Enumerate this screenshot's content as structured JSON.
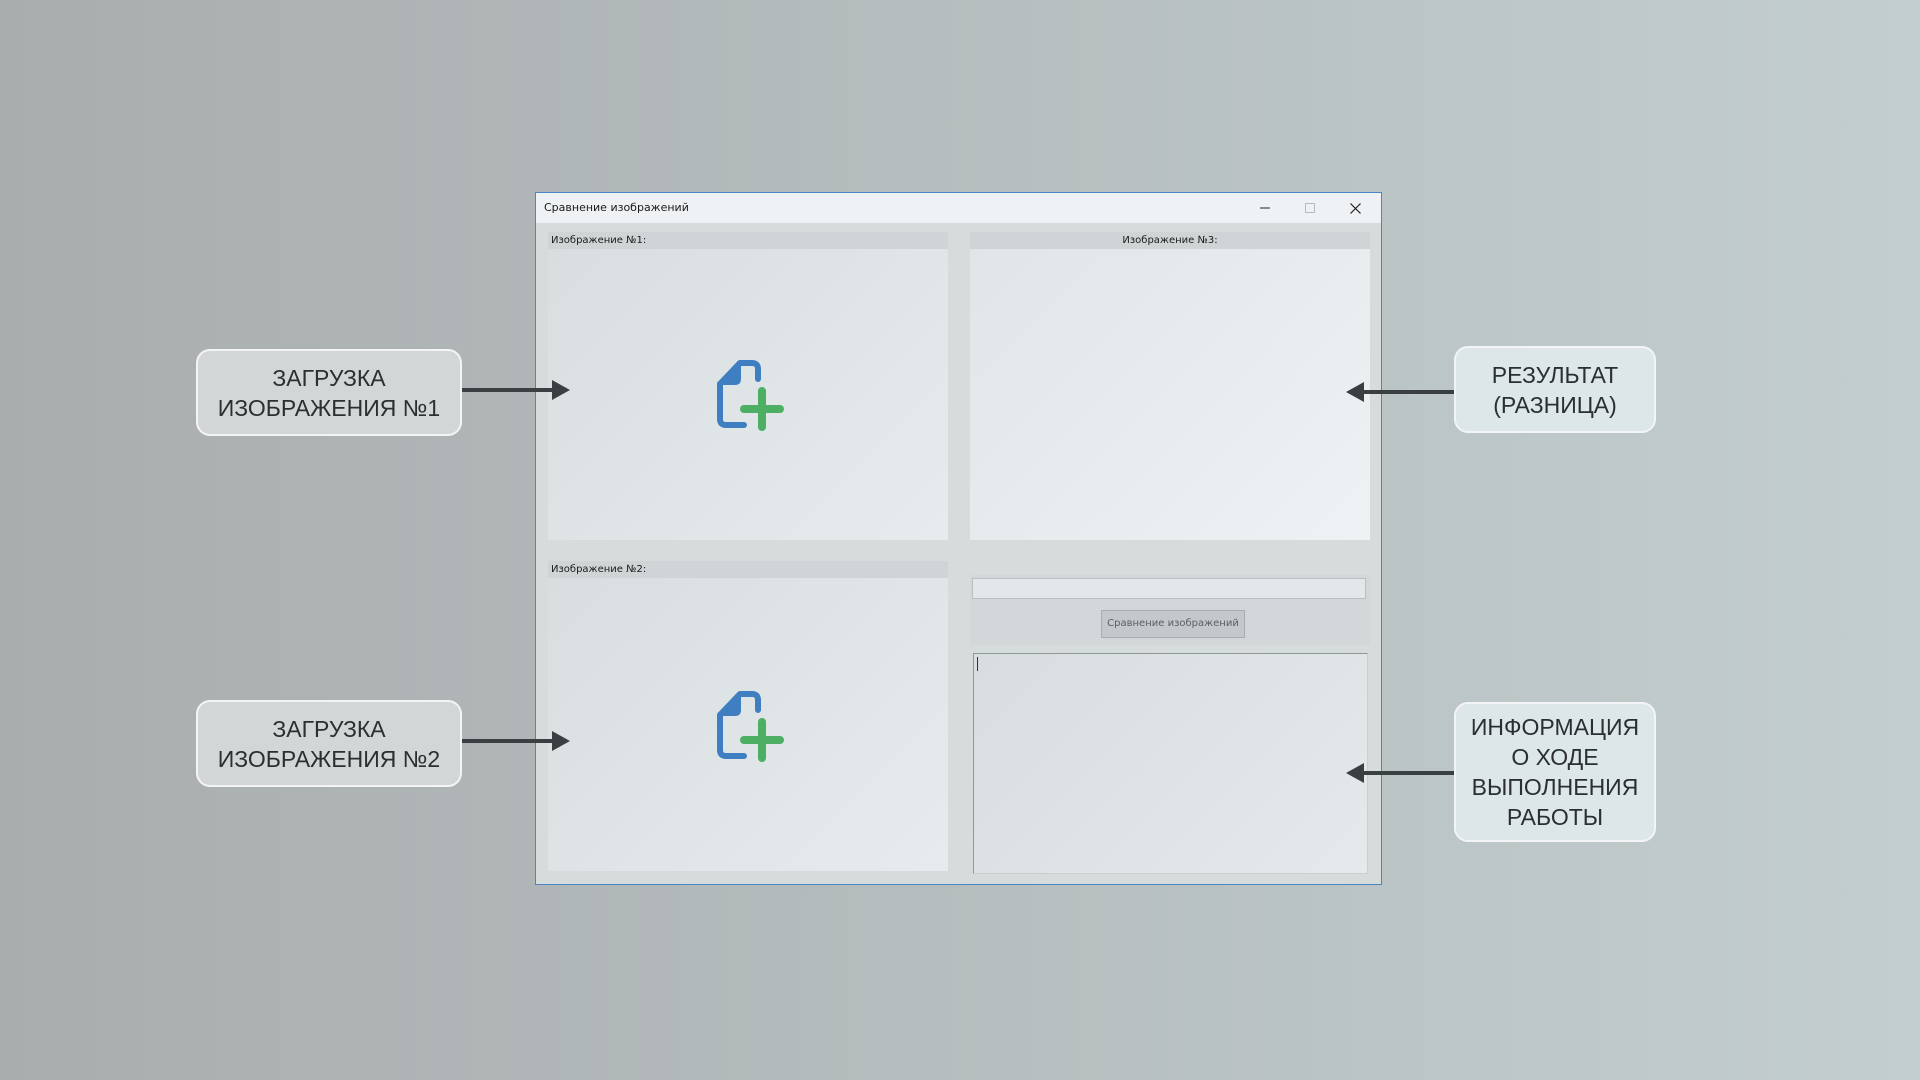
{
  "window": {
    "title": "Сравнение изображений",
    "accent_color": "#4b86c4",
    "icons": {
      "minimize": "minimize-icon",
      "maximize": "maximize-icon",
      "close": "close-icon"
    }
  },
  "panels": {
    "image1": {
      "label": "Изображение №1:",
      "icon": "add-file-icon"
    },
    "image2": {
      "label": "Изображение №2:",
      "icon": "add-file-icon"
    },
    "image3": {
      "label": "Изображение №3:"
    }
  },
  "controls": {
    "progress": 0,
    "compare_button": "Сравнение изображений"
  },
  "log": {
    "text": ""
  },
  "callouts": {
    "load_image1": "ЗАГРУЗКА\nИЗОБРАЖЕНИЯ №1",
    "load_image2": "ЗАГРУЗКА\nИЗОБРАЖЕНИЯ №2",
    "result": "РЕЗУЛЬТАТ\n(РАЗНИЦА)",
    "progress_info": "ИНФОРМАЦИЯ\nО ХОДЕ\nВЫПОЛНЕНИЯ\nРАБОТЫ"
  },
  "colors": {
    "icon_blue": "#3f7fc1",
    "icon_green": "#4caf63",
    "arrow": "#3a3f42"
  }
}
